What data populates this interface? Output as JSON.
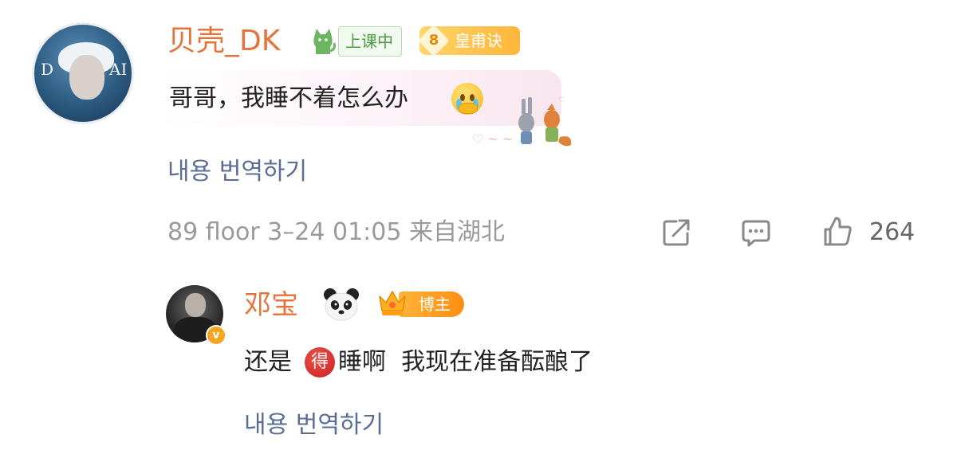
{
  "comment": {
    "username": "贝壳_DK",
    "status_badge": "上课中",
    "level_badge": {
      "level": "8",
      "label": "皇甫诀"
    },
    "avatar_text_left": "D",
    "avatar_text_right": "AI",
    "text": "哥哥，我睡不着怎么办",
    "emoji_icon": "crying-face-icon",
    "sticker_icon": "cartoon-sticker-icon",
    "translate_label": "내용 번역하기",
    "meta": "89 floor 3–24 01:05  来自湖北",
    "actions": {
      "share_icon": "share-icon",
      "comment_icon": "comment-icon",
      "like_icon": "like-icon",
      "like_count": "264"
    }
  },
  "reply": {
    "username": "邓宝",
    "panda_icon": "panda-icon",
    "host_badge": "博主",
    "verified_icon": "verified-icon",
    "text_before": "还是",
    "inline_badge": "得",
    "text_after": "睡啊  我现在准备酝酿了",
    "translate_label": "내용 번역하기"
  },
  "colors": {
    "username": "#e4743b",
    "translate_link": "#5a6d97",
    "meta": "#9a9a9a",
    "badge_gold": "#ffb33b",
    "badge_green": "#4f9a45"
  }
}
